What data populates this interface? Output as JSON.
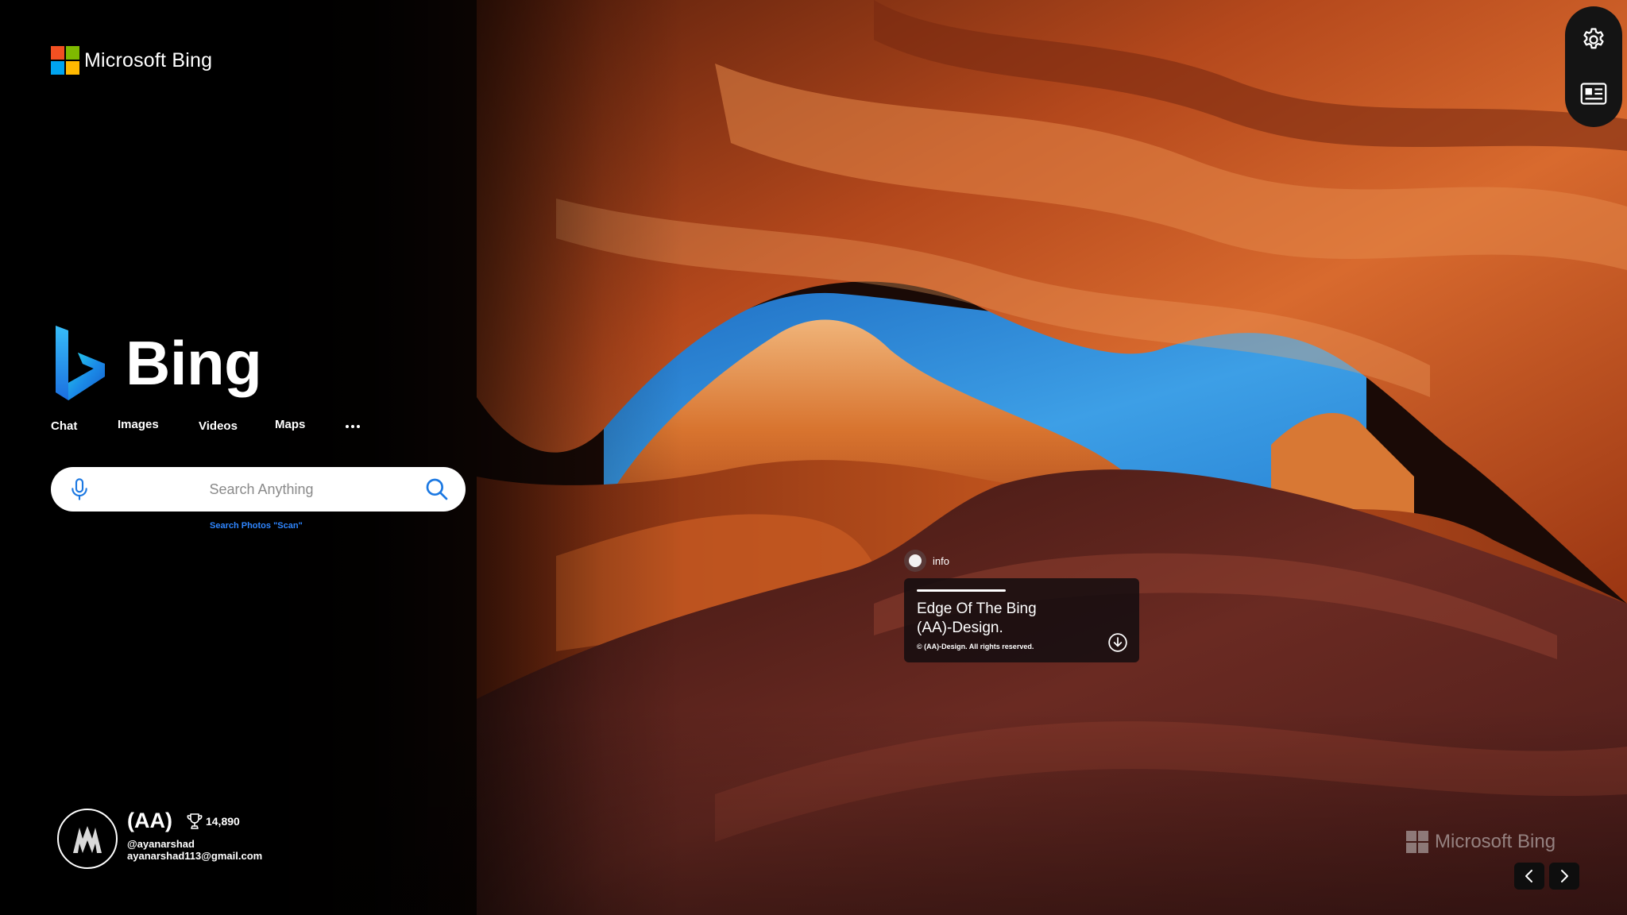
{
  "brand": {
    "text": "Microsoft Bing",
    "logo_icon": "microsoft-logo-icon"
  },
  "rail": {
    "settings_icon": "gear-icon",
    "news_icon": "news-feed-icon"
  },
  "logo": {
    "wordmark": "Bing",
    "icon": "bing-b-icon"
  },
  "nav": {
    "items": [
      {
        "label": "Chat"
      },
      {
        "label": "Images"
      },
      {
        "label": "Videos"
      },
      {
        "label": "Maps"
      }
    ],
    "more_icon": "ellipsis-icon"
  },
  "search": {
    "placeholder": "Search Anything",
    "mic_icon": "microphone-icon",
    "search_icon": "search-icon",
    "hint": "Search Photos \"Scan\""
  },
  "info": {
    "toggle_label": "info",
    "title_line1": "Edge Of The Bing",
    "title_line2": "(AA)-Design.",
    "copyright": "© (AA)-Design. All rights reserved.",
    "download_icon": "download-icon"
  },
  "profile": {
    "name": "(AA)",
    "points": "14,890",
    "handle": "@ayanarshad",
    "email": "ayanarshad113@gmail.com",
    "trophy_icon": "trophy-icon"
  },
  "watermark": {
    "text": "Microsoft Bing"
  },
  "carousel": {
    "prev_icon": "chevron-left-icon",
    "next_icon": "chevron-right-icon"
  },
  "colors": {
    "accent": "#2f86ff",
    "bing_blue": "#1b78e2",
    "canyon": "#b8481a",
    "sky": "#2f8ad8"
  }
}
